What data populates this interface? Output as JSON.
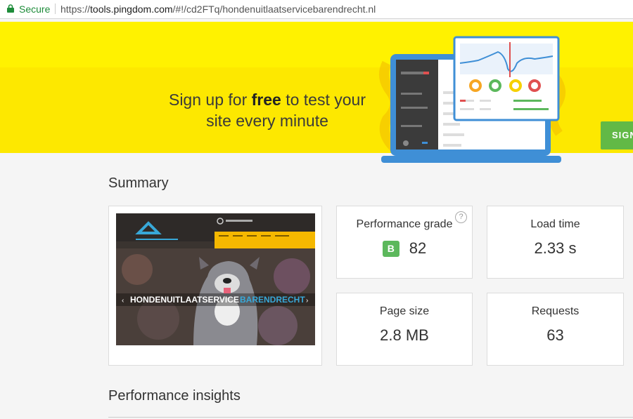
{
  "browser": {
    "secure_label": "Secure",
    "url_scheme": "https://",
    "url_host": "tools.pingdom.com",
    "url_path": "/#!/cd2FTq/hondenuitlaatservicebarendrecht.nl"
  },
  "banner": {
    "headline_part1": "Sign up for ",
    "headline_bold": "free",
    "headline_part2": " to test your site every minute",
    "signup_button": "SIGN"
  },
  "summary": {
    "title": "Summary",
    "screenshot": {
      "site_title": "HONDENUITLAATSERVICE",
      "site_title_accent": "BARENDRECHT",
      "phone": "06-12637961"
    },
    "metrics": {
      "performance": {
        "label": "Performance grade",
        "grade": "B",
        "score": "82",
        "help": "?"
      },
      "load_time": {
        "label": "Load time",
        "value": "2.33 s"
      },
      "page_size": {
        "label": "Page size",
        "value": "2.8 MB"
      },
      "requests": {
        "label": "Requests",
        "value": "63"
      }
    }
  },
  "insights": {
    "title": "Performance insights"
  },
  "colors": {
    "banner": "#fde800",
    "signup": "#62b946",
    "grade": "#5cb85c",
    "secure": "#1e8c3a"
  }
}
